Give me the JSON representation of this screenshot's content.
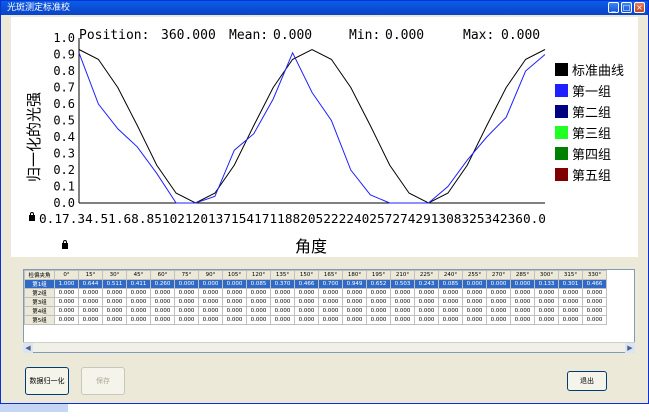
{
  "window": {
    "title": "光斑测定标准校"
  },
  "chart": {
    "readout": {
      "position_label": "Position:",
      "position_value": "360.000",
      "mean_label": "Mean:",
      "mean_value": "0.000",
      "min_label": "Min:",
      "min_value": "0.000",
      "max_label": "Max:",
      "max_value": "0.000"
    },
    "ylabel": "归一化的光强",
    "xlabel": "角度",
    "xticks_text": "0.17.34.51.68.85102120137154171188205222240257274291308325342360.0",
    "ytick_labels": [
      "1.0",
      "0.9",
      "0.8",
      "0.7",
      "0.6",
      "0.5",
      "0.4",
      "0.3",
      "0.2",
      "0.1",
      "0.0"
    ],
    "legend": [
      {
        "label": "标准曲线",
        "color": "#000000"
      },
      {
        "label": "第一组",
        "color": "#1f1fff"
      },
      {
        "label": "第二组",
        "color": "#000080"
      },
      {
        "label": "第三组",
        "color": "#22ff22"
      },
      {
        "label": "第四组",
        "color": "#008000"
      },
      {
        "label": "第五组",
        "color": "#800000"
      }
    ]
  },
  "chart_data": {
    "type": "line",
    "xlim": [
      0,
      360
    ],
    "ylim": [
      0,
      1.0
    ],
    "ylabel": "归一化的光强",
    "xlabel": "角度",
    "series": [
      {
        "name": "标准曲线",
        "color": "#000000",
        "x": [
          0,
          15,
          30,
          45,
          60,
          75,
          90,
          105,
          120,
          135,
          150,
          165,
          180,
          195,
          210,
          225,
          240,
          255,
          270,
          285,
          300,
          315,
          330,
          345,
          360
        ],
        "y": [
          0.93,
          0.87,
          0.7,
          0.47,
          0.23,
          0.06,
          0.0,
          0.06,
          0.23,
          0.47,
          0.7,
          0.87,
          0.93,
          0.87,
          0.7,
          0.47,
          0.23,
          0.06,
          0.0,
          0.06,
          0.23,
          0.47,
          0.7,
          0.87,
          0.93
        ]
      },
      {
        "name": "第一组",
        "color": "#1f1fff",
        "x": [
          0,
          15,
          30,
          45,
          60,
          75,
          90,
          105,
          120,
          135,
          150,
          165,
          180,
          195,
          210,
          225,
          240,
          255,
          270,
          285,
          300,
          315,
          330,
          345,
          360
        ],
        "y": [
          0.91,
          0.6,
          0.45,
          0.34,
          0.18,
          0.0,
          0.0,
          0.04,
          0.32,
          0.42,
          0.63,
          0.91,
          0.67,
          0.5,
          0.2,
          0.05,
          0.0,
          0.0,
          0.0,
          0.1,
          0.26,
          0.4,
          0.52,
          0.8,
          0.9
        ]
      }
    ]
  },
  "table": {
    "headers": [
      "检偏夹角",
      "0°",
      "15°",
      "30°",
      "45°",
      "60°",
      "75°",
      "90°",
      "105°",
      "120°",
      "135°",
      "150°",
      "165°",
      "180°",
      "195°",
      "210°",
      "225°",
      "240°",
      "255°",
      "270°",
      "285°",
      "300°",
      "315°",
      "330°"
    ],
    "rows": [
      {
        "label": "第1组",
        "values": [
          "1.000",
          "0.644",
          "0.511",
          "0.411",
          "0.260",
          "0.000",
          "0.000",
          "0.000",
          "0.085",
          "0.370",
          "0.466",
          "0.700",
          "0.949",
          "0.652",
          "0.503",
          "0.243",
          "0.085",
          "0.000",
          "0.000",
          "0.000",
          "0.133",
          "0.301",
          "0.466"
        ]
      },
      {
        "label": "第2组",
        "values": [
          "0.000",
          "0.000",
          "0.000",
          "0.000",
          "0.000",
          "0.000",
          "0.000",
          "0.000",
          "0.000",
          "0.000",
          "0.000",
          "0.000",
          "0.000",
          "0.000",
          "0.000",
          "0.000",
          "0.000",
          "0.000",
          "0.000",
          "0.000",
          "0.000",
          "0.000",
          "0.000"
        ]
      },
      {
        "label": "第3组",
        "values": [
          "0.000",
          "0.000",
          "0.000",
          "0.000",
          "0.000",
          "0.000",
          "0.000",
          "0.000",
          "0.000",
          "0.000",
          "0.000",
          "0.000",
          "0.000",
          "0.000",
          "0.000",
          "0.000",
          "0.000",
          "0.000",
          "0.000",
          "0.000",
          "0.000",
          "0.000",
          "0.000"
        ]
      },
      {
        "label": "第4组",
        "values": [
          "0.000",
          "0.000",
          "0.000",
          "0.000",
          "0.000",
          "0.000",
          "0.000",
          "0.000",
          "0.000",
          "0.000",
          "0.000",
          "0.000",
          "0.000",
          "0.000",
          "0.000",
          "0.000",
          "0.000",
          "0.000",
          "0.000",
          "0.000",
          "0.000",
          "0.000",
          "0.000"
        ]
      },
      {
        "label": "第5组",
        "values": [
          "0.000",
          "0.000",
          "0.000",
          "0.000",
          "0.000",
          "0.000",
          "0.000",
          "0.000",
          "0.000",
          "0.000",
          "0.000",
          "0.000",
          "0.000",
          "0.000",
          "0.000",
          "0.000",
          "0.000",
          "0.000",
          "0.000",
          "0.000",
          "0.000",
          "0.000",
          "0.000"
        ]
      }
    ]
  },
  "buttons": {
    "normalize": "数据归一化",
    "disabled_action": "保存",
    "exit": "退出"
  }
}
